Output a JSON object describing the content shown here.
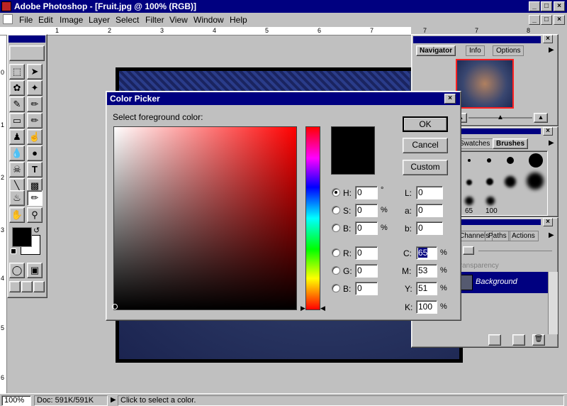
{
  "app": {
    "title": "Adobe Photoshop - [Fruit.jpg @ 100% (RGB)]",
    "window_controls": [
      "_",
      "□",
      "×"
    ]
  },
  "menu": [
    "File",
    "Edit",
    "Image",
    "Layer",
    "Select",
    "Filter",
    "View",
    "Window",
    "Help"
  ],
  "ruler": {
    "top": [
      "1",
      "2",
      "3",
      "4",
      "5",
      "6",
      "7",
      "8"
    ],
    "left": [
      "0",
      "1",
      "2",
      "3",
      "4",
      "5",
      "6"
    ]
  },
  "color_picker": {
    "title": "Color Picker",
    "prompt": "Select foreground color:",
    "buttons": {
      "ok": "OK",
      "cancel": "Cancel",
      "custom": "Custom"
    },
    "hsb": [
      {
        "label": "H:",
        "value": "0",
        "unit": "°",
        "selected": true
      },
      {
        "label": "S:",
        "value": "0",
        "unit": "%",
        "selected": false
      },
      {
        "label": "B:",
        "value": "0",
        "unit": "%",
        "selected": false
      }
    ],
    "rgb": [
      {
        "label": "R:",
        "value": "0"
      },
      {
        "label": "G:",
        "value": "0"
      },
      {
        "label": "B:",
        "value": "0"
      }
    ],
    "lab": [
      {
        "label": "L:",
        "value": "0"
      },
      {
        "label": "a:",
        "value": "0"
      },
      {
        "label": "b:",
        "value": "0"
      }
    ],
    "cmyk": [
      {
        "label": "C:",
        "value": "65",
        "unit": "%"
      },
      {
        "label": "M:",
        "value": "53",
        "unit": "%"
      },
      {
        "label": "Y:",
        "value": "51",
        "unit": "%"
      },
      {
        "label": "K:",
        "value": "100",
        "unit": "%"
      }
    ]
  },
  "navigator_palette": {
    "tabs": [
      "Navigator",
      "Info",
      "Options"
    ]
  },
  "brushes_palette": {
    "tabs": [
      "Swatches",
      "Brushes"
    ],
    "sizes": [
      "65",
      "100"
    ]
  },
  "layers_palette": {
    "tabs": [
      "Channels",
      "Paths",
      "Actions"
    ],
    "transparency": "Transparency",
    "layer_name": "Background"
  },
  "status": {
    "zoom": "100%",
    "doc": "Doc: 591K/591K",
    "hint": "Click to select a color."
  },
  "colors": {
    "titlebar": "#000080",
    "face": "#c0c0c0",
    "foreground": "#000000",
    "background": "#ffffff"
  }
}
